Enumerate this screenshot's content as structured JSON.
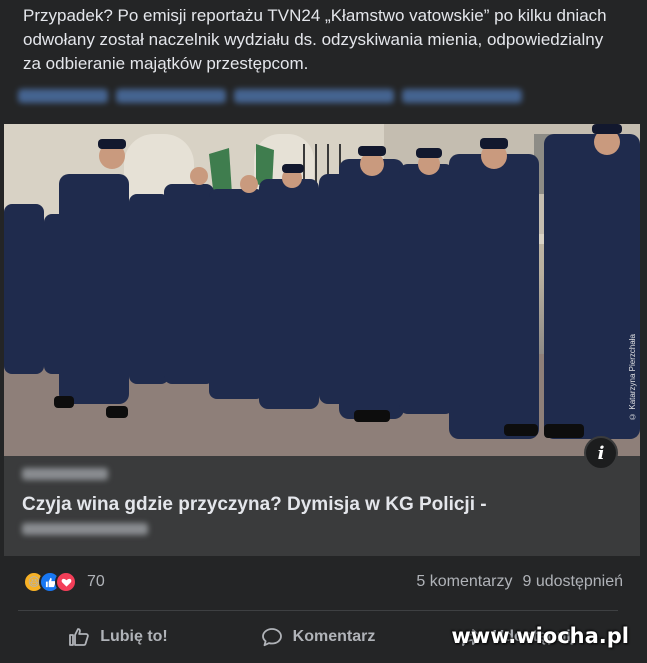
{
  "post": {
    "text": "Przypadek? Po emisji reportażu TVN24 „Kłamstwo vatowskie” po kilku dniach odwołany został naczelnik wydziału ds. odzyskiwania mienia, odpowiedzialny za odbieranie majątków przestępcom."
  },
  "link_card": {
    "photo_credit": "© Katarzyna Pierzchała",
    "info_icon": "info-icon",
    "title": "Czyja wina gdzie przyczyna? Dymisja w KG Policji -"
  },
  "reactions": {
    "icons": [
      "haha-icon",
      "like-icon",
      "love-icon"
    ],
    "count": "70",
    "comments": "5 komentarzy",
    "shares": "9 udostępnień"
  },
  "actions": {
    "like": "Lubię to!",
    "comment": "Komentarz",
    "share": "Udostępnij"
  },
  "watermark": "www.wiocha.pl",
  "colors": {
    "background": "#242526",
    "card": "#3a3b3c",
    "like_blue": "#1877f2",
    "love_red": "#f33e58",
    "haha_yellow": "#f7b125"
  }
}
